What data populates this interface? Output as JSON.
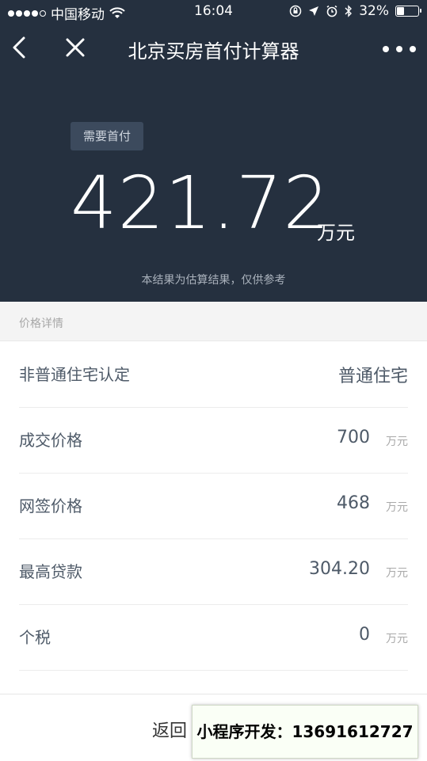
{
  "status_bar": {
    "carrier": "中国移动",
    "time": "16:04",
    "battery": "32%"
  },
  "nav": {
    "title": "北京买房首付计算器",
    "back_icon": "chevron-left-icon",
    "close_icon": "close-icon",
    "more_icon": "more-dots-icon"
  },
  "result": {
    "badge": "需要首付",
    "amount": "421.72",
    "unit": "万元",
    "note": "本结果为估算结果，仅供参考"
  },
  "details": {
    "section_label": "价格详情",
    "rows": [
      {
        "label": "非普通住宅认定",
        "value": "普通住宅",
        "unit": ""
      },
      {
        "label": "成交价格",
        "value": "700",
        "unit": "万元"
      },
      {
        "label": "网签价格",
        "value": "468",
        "unit": "万元"
      },
      {
        "label": "最高贷款",
        "value": "304.20",
        "unit": "万元"
      },
      {
        "label": "个税",
        "value": "0",
        "unit": "万元"
      }
    ]
  },
  "bottom": {
    "return_label": "返回"
  },
  "watermark": "小程序开发：13691612727",
  "colors": {
    "header_bg": "#25303f",
    "badge_bg": "#3c4a5d",
    "text": "#4e5a68"
  }
}
